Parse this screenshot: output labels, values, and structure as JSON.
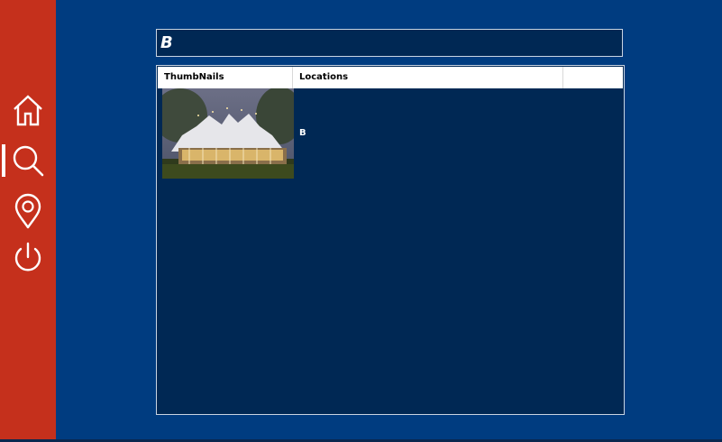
{
  "search": {
    "value": "B"
  },
  "nav": [
    {
      "id": "home",
      "icon": "home-icon"
    },
    {
      "id": "search",
      "icon": "search-icon",
      "active": true
    },
    {
      "id": "locations",
      "icon": "location-pin-icon"
    },
    {
      "id": "power",
      "icon": "power-icon"
    }
  ],
  "grid": {
    "columns": [
      "ThumbNails",
      "Locations",
      ""
    ],
    "rows": [
      {
        "thumbnail": "tent-event-photo",
        "location": "B"
      }
    ]
  },
  "colors": {
    "background": "#003c80",
    "sidebar": "#c5301c",
    "panel": "#002854",
    "header_bg": "#ffffff",
    "icon": "#ffffff"
  }
}
